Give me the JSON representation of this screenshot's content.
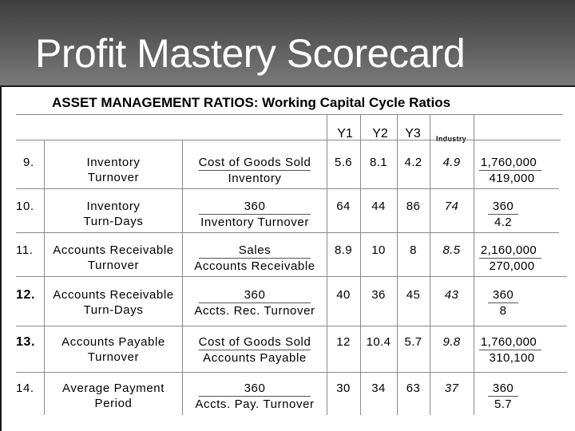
{
  "header": {
    "title": "Profit Mastery Scorecard"
  },
  "subtitle": "ASSET MANAGEMENT RATIOS:  Working Capital Cycle Ratios",
  "columns": {
    "y1": "Y1",
    "y2": "Y2",
    "y3": "Y3",
    "industry": "Industry"
  },
  "rows": [
    {
      "num": "9.",
      "name1": "Inventory",
      "name2": "Turnover",
      "formula_num": "Cost of Goods Sold",
      "formula_den": "Inventory",
      "y1": "5.6",
      "y2": "8.1",
      "y3": "4.2",
      "industry": "4.9",
      "calc_num": "1,760,000",
      "calc_den": "419,000"
    },
    {
      "num": "10.",
      "name1": "Inventory",
      "name2": "Turn-Days",
      "formula_num": "360",
      "formula_den": "Inventory Turnover",
      "y1": "64",
      "y2": "44",
      "y3": "86",
      "industry": "74",
      "calc_num": "360",
      "calc_den": "4.2"
    },
    {
      "num": "11.",
      "name1": "Accounts Receivable",
      "name2": "Turnover",
      "formula_num": "Sales",
      "formula_den": "Accounts Receivable",
      "y1": "8.9",
      "y2": "10",
      "y3": "8",
      "industry": "8.5",
      "calc_num": "2,160,000",
      "calc_den": "270,000"
    },
    {
      "num": "12.",
      "name1": "Accounts Receivable",
      "name2": "Turn-Days",
      "formula_num": "360",
      "formula_den": "Accts. Rec. Turnover",
      "y1": "40",
      "y2": "36",
      "y3": "45",
      "industry": "43",
      "calc_num": "360",
      "calc_den": "8"
    },
    {
      "num": "13.",
      "name1": "Accounts Payable",
      "name2": "Turnover",
      "formula_num": "Cost of Goods Sold",
      "formula_den": "Accounts Payable",
      "y1": "12",
      "y2": "10.4",
      "y3": "5.7",
      "industry": "9.8",
      "calc_num": "1,760,000",
      "calc_den": "310,100"
    },
    {
      "num": "14.",
      "name1": "Average Payment",
      "name2": "Period",
      "formula_num": "360",
      "formula_den": "Accts. Pay. Turnover",
      "y1": "30",
      "y2": "34",
      "y3": "63",
      "industry": "37",
      "calc_num": "360",
      "calc_den": "5.7"
    }
  ]
}
